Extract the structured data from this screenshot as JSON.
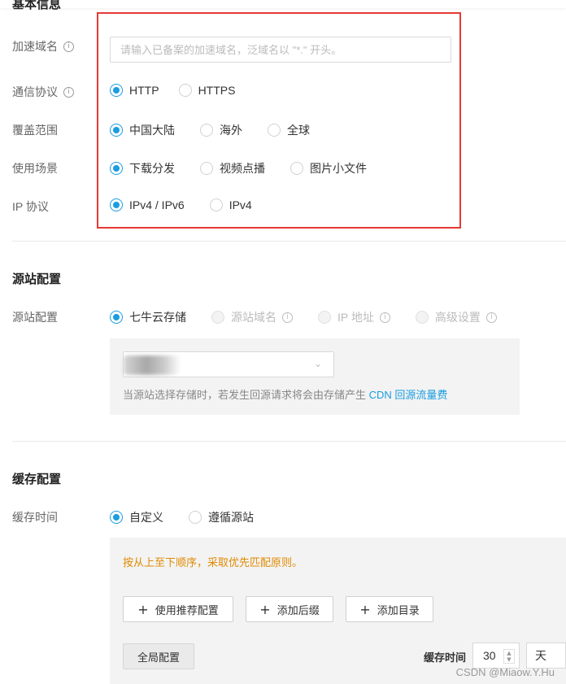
{
  "basic_info": {
    "title": "基本信息",
    "domain": {
      "label": "加速域名",
      "placeholder": "请输入已备案的加速域名，泛域名以 \"*.\" 开头。"
    },
    "protocol": {
      "label": "通信协议",
      "options": [
        "HTTP",
        "HTTPS"
      ],
      "selected": "HTTP"
    },
    "coverage": {
      "label": "覆盖范围",
      "options": [
        "中国大陆",
        "海外",
        "全球"
      ],
      "selected": "中国大陆"
    },
    "scenario": {
      "label": "使用场景",
      "options": [
        "下载分发",
        "视频点播",
        "图片小文件"
      ],
      "selected": "下载分发"
    },
    "ip_protocol": {
      "label": "IP 协议",
      "options": [
        "IPv4 / IPv6",
        "IPv4"
      ],
      "selected": "IPv4 / IPv6"
    }
  },
  "origin": {
    "title": "源站配置",
    "label": "源站配置",
    "options": [
      "七牛云存储",
      "源站域名",
      "IP 地址",
      "高级设置"
    ],
    "selected": "七牛云存储",
    "hint_prefix": "当源站选择存储时，若发生回源请求将会由存储产生",
    "hint_link": "CDN 回源流量费"
  },
  "cache": {
    "title": "缓存配置",
    "label": "缓存时间",
    "options": [
      "自定义",
      "遵循源站"
    ],
    "selected": "自定义",
    "note": "按从上至下顺序，采取优先匹配原则。",
    "buttons": [
      "使用推荐配置",
      "添加后缀",
      "添加目录"
    ],
    "global_button": "全局配置",
    "time_label": "缓存时间",
    "time_value": "30",
    "time_unit": "天"
  },
  "colors": {
    "accent": "#1a9de0",
    "highlight_border": "#e53935",
    "note": "#e08a00"
  },
  "watermark": "CSDN @Miaow.Y.Hu"
}
